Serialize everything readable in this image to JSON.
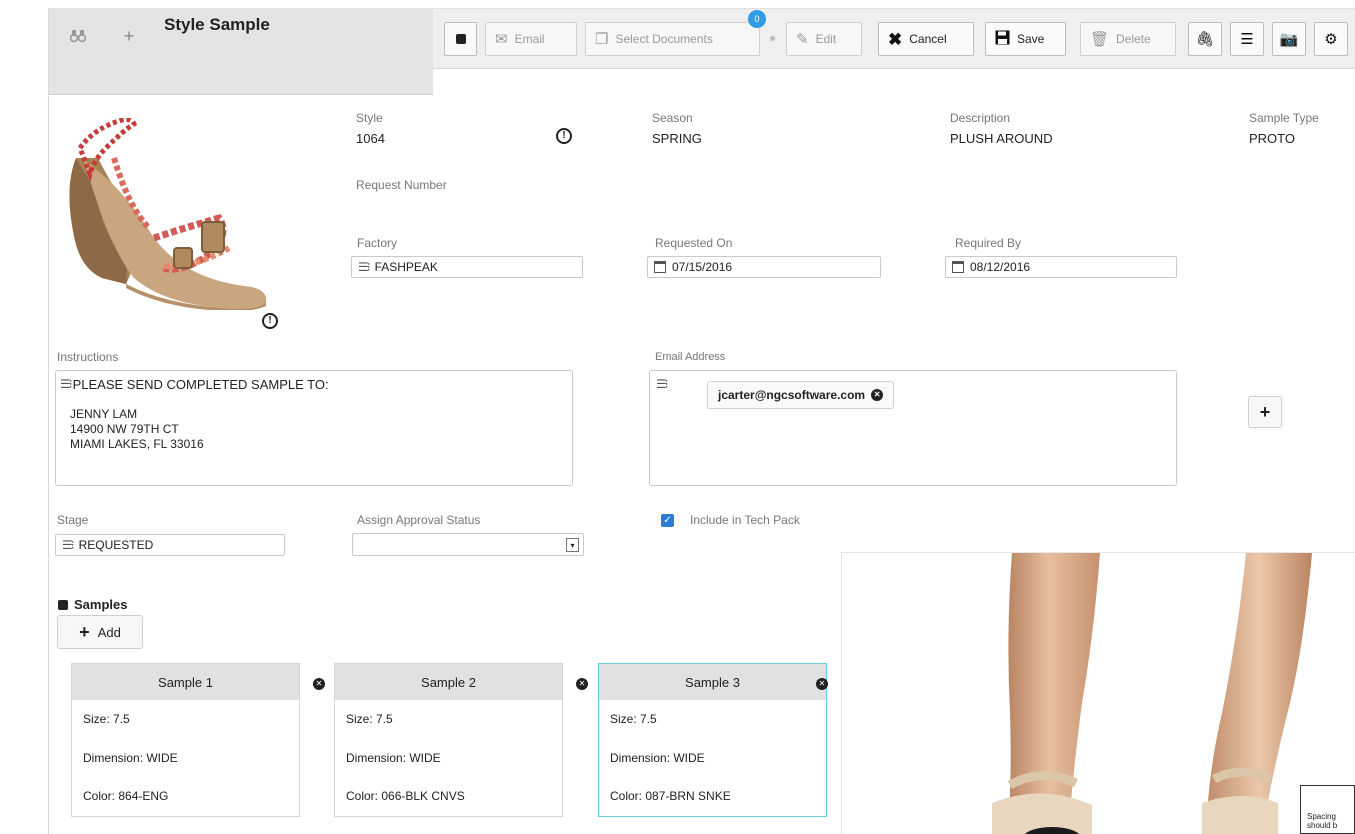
{
  "toolbar": {
    "title": "Style Sample",
    "email_label": "Email",
    "select_docs_label": "Select Documents",
    "select_docs_badge": "0",
    "edit_label": "Edit",
    "cancel_label": "Cancel",
    "save_label": "Save",
    "delete_label": "Delete"
  },
  "header": {
    "style_label": "Style",
    "style_value": "1064",
    "season_label": "Season",
    "season_value": "SPRING",
    "description_label": "Description",
    "description_value": "PLUSH AROUND",
    "sample_type_label": "Sample Type",
    "sample_type_value": "PROTO",
    "request_number_label": "Request Number"
  },
  "fields": {
    "factory_label": "Factory",
    "factory_value": "FASHPEAK",
    "requested_on_label": "Requested On",
    "requested_on_value": "07/15/2016",
    "required_by_label": "Required By",
    "required_by_value": "08/12/2016",
    "instructions_label": "Instructions",
    "instructions_line1": "PLEASE SEND COMPLETED SAMPLE TO:",
    "instructions_line2": "JENNY LAM",
    "instructions_line3": "14900 NW 79TH CT",
    "instructions_line4": "MIAMI LAKES, FL 33016",
    "email_label": "Email Address",
    "email_chip": "jcarter@ngcsoftware.com",
    "stage_label": "Stage",
    "stage_value": "REQUESTED",
    "approval_label": "Assign Approval Status",
    "approval_value": "",
    "techpack_label": "Include in Tech Pack",
    "techpack_checked": true
  },
  "samples": {
    "heading": "Samples",
    "add_label": "Add",
    "items": [
      {
        "title": "Sample 1",
        "size": "Size: 7.5",
        "dimension": "Dimension: WIDE",
        "color": "Color: 864-ENG"
      },
      {
        "title": "Sample 2",
        "size": "Size: 7.5",
        "dimension": "Dimension: WIDE",
        "color": "Color: 066-BLK CNVS"
      },
      {
        "title": "Sample 3",
        "size": "Size: 7.5",
        "dimension": "Dimension: WIDE",
        "color": "Color: 087-BRN SNKE"
      }
    ]
  },
  "overlay": {
    "note_line1": "Spacing",
    "note_line2": "should b"
  },
  "colors": {
    "accent": "#2c7bd6",
    "badge": "#2e9be6",
    "selected_card_border": "#6ccfd8"
  }
}
